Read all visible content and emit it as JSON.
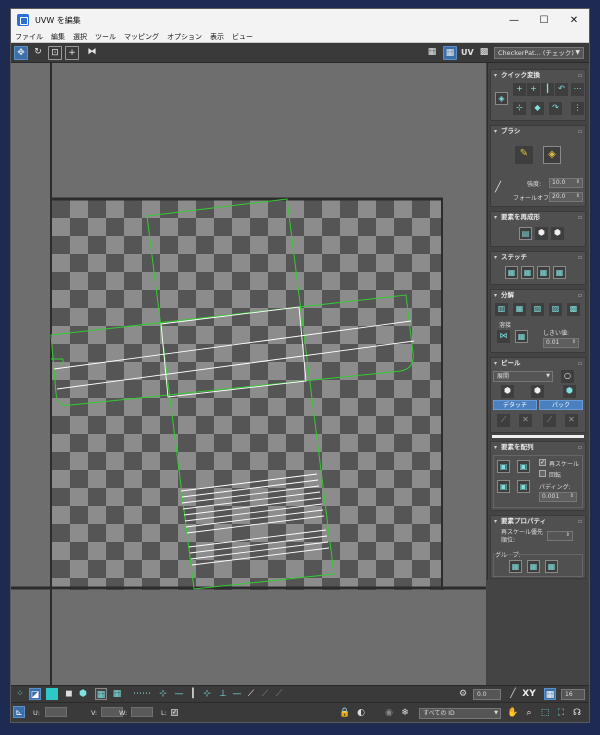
{
  "window": {
    "title": "UVW を編集",
    "controls": {
      "minimize": "—",
      "maximize": "☐",
      "close": "✕"
    }
  },
  "menu": [
    "ファイル",
    "編集",
    "選択",
    "ツール",
    "マッピング",
    "オプション",
    "表示",
    "ビュー"
  ],
  "toolbar": {
    "uv_label": "UV",
    "texture_select": "CheckerPat... (チェック)"
  },
  "panel": {
    "quick_transform": {
      "title": "クイック変換"
    },
    "brush": {
      "title": "ブラシ",
      "strength_label": "強度:",
      "strength_value": "10.0",
      "falloff_label": "フォールオフ:",
      "falloff_value": "20.0"
    },
    "reshape": {
      "title": "要素を再成形"
    },
    "stitch": {
      "title": "ステッチ"
    },
    "explode": {
      "title": "分解",
      "weld_label": "溶接",
      "threshold_label": "しきい値:",
      "threshold_value": "0.01"
    },
    "peel": {
      "title": "ピール",
      "select_value": "展開",
      "detach_label": "デタッチ",
      "pack_label": "パック"
    },
    "arrange": {
      "title": "要素を配列",
      "rescale_label": "再スケール",
      "rotate_label": "回転",
      "padding_label": "パディング:",
      "padding_value": "0.001"
    },
    "properties": {
      "title": "要素プロパティ",
      "rescale_priority_label": "再スケール優先順位:",
      "group_label": "グループ:"
    }
  },
  "status": {
    "zoom_value": "0.0",
    "xy_label": "XY",
    "grid_value": "16",
    "u_label": "U:",
    "v_label": "V:",
    "w_label": "W:",
    "l_label": "L:",
    "id_select": "すべての ID"
  },
  "colors": {
    "accent": "#3c6ea8",
    "uv_selection": "#33cc33",
    "uv_edges": "#ffffff",
    "checker_dark": "#555555",
    "checker_light": "#8c8c8c"
  }
}
